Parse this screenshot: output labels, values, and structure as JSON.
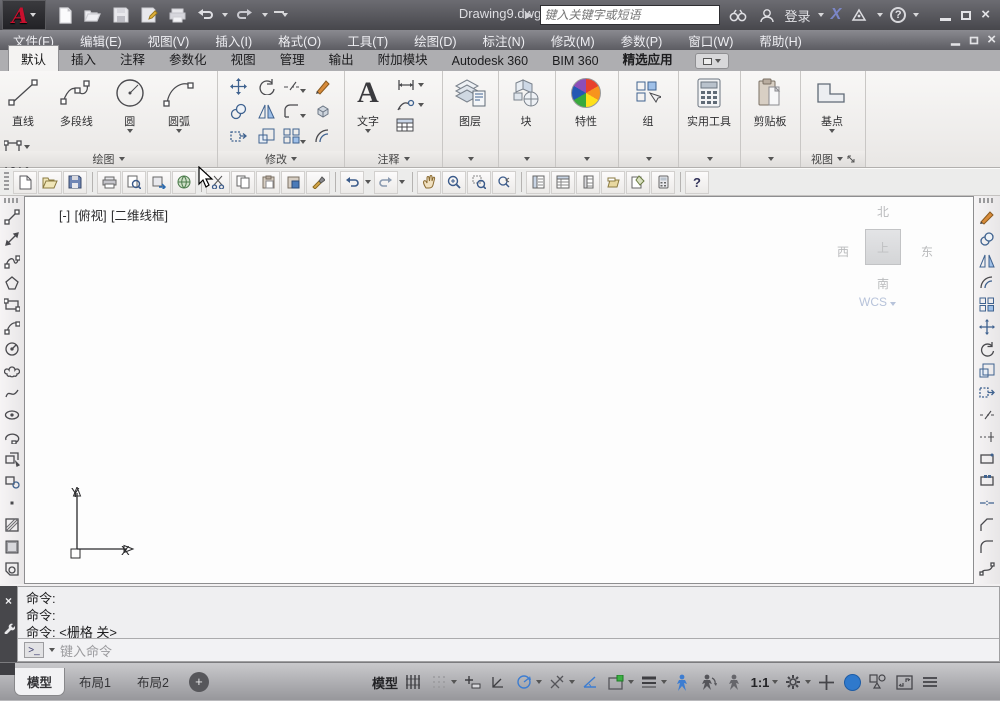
{
  "colors": {
    "accent_blue": "#3d7dd1",
    "logo_red": "#c8102e",
    "canvas": "#fdfdfd",
    "titlebar_gray": "#55555a"
  },
  "titlebar": {
    "title": "Drawing9.dwg",
    "search_placeholder": "键入关键字或短语",
    "signin": "登录",
    "exchange": "X",
    "help": "?"
  },
  "menubar": {
    "items": [
      "文件(F)",
      "编辑(E)",
      "视图(V)",
      "插入(I)",
      "格式(O)",
      "工具(T)",
      "绘图(D)",
      "标注(N)",
      "修改(M)",
      "参数(P)",
      "窗口(W)",
      "帮助(H)"
    ]
  },
  "ribbon_tabs": {
    "items": [
      "默认",
      "插入",
      "注释",
      "参数化",
      "视图",
      "管理",
      "输出",
      "附加模块",
      "Autodesk 360",
      "BIM 360",
      "精选应用"
    ]
  },
  "ribbon": {
    "draw": {
      "footer": "绘图",
      "line": "直线",
      "polyline": "多段线",
      "circle": "圆",
      "arc": "圆弧"
    },
    "modify": {
      "footer": "修改"
    },
    "annotate": {
      "footer": "注释",
      "text": "文字",
      "text_icon": "A"
    },
    "layers": {
      "label": "图层"
    },
    "block": {
      "label": "块"
    },
    "properties": {
      "label": "特性"
    },
    "group": {
      "label": "组"
    },
    "utilities": {
      "label": "实用工具"
    },
    "clipboard": {
      "label": "剪贴板"
    },
    "view": {
      "footer": "视图",
      "base": "基点"
    }
  },
  "viewport": {
    "controls": [
      "[-]",
      "[俯视]",
      "[二维线框]"
    ],
    "viewcube": {
      "n": "北",
      "s": "南",
      "w": "西",
      "e": "东",
      "top": "上",
      "wcs": "WCS"
    },
    "ucs": {
      "x": "X",
      "y": "Y"
    }
  },
  "command": {
    "history": [
      "命令:",
      "命令:",
      "命令:  <栅格 关>"
    ],
    "placeholder": "键入命令",
    "prompt": ">_"
  },
  "statusbar": {
    "tabs": [
      "模型",
      "布局1",
      "布局2"
    ],
    "model": "模型",
    "scale": "1:1"
  }
}
